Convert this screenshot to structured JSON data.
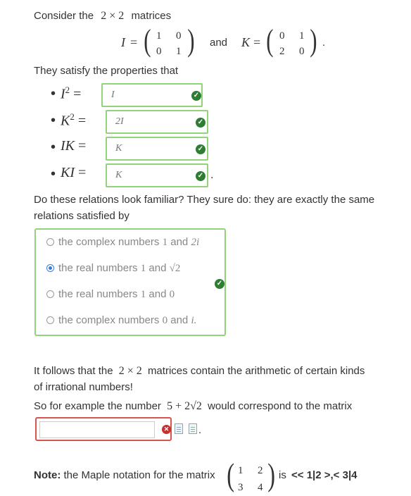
{
  "intro": {
    "text": "Consider the",
    "size_expr": "2 × 2",
    "suffix": "matrices"
  },
  "matrices": {
    "I_label": "I",
    "I_rows": [
      [
        "1",
        "0"
      ],
      [
        "0",
        "1"
      ]
    ],
    "and_text": "and",
    "K_label": "K",
    "K_rows": [
      [
        "0",
        "1"
      ],
      [
        "2",
        "0"
      ]
    ],
    "equals": "=",
    "period": "."
  },
  "properties": {
    "intro": "They satisfy the properties that",
    "items": [
      {
        "lhs_var": "I",
        "lhs_exp": "2",
        "answer": "I",
        "status": "correct"
      },
      {
        "lhs_var": "K",
        "lhs_exp": "2",
        "answer": "2I",
        "status": "correct"
      },
      {
        "lhs_var": "IK",
        "lhs_exp": "",
        "answer": "K",
        "status": "correct"
      },
      {
        "lhs_var": "KI",
        "lhs_exp": "",
        "answer": "K",
        "status": "correct"
      }
    ],
    "bullet": "•",
    "trailing": "."
  },
  "question": {
    "line1": "Do these relations look familiar? They sure do: they are exactly the same",
    "line2": "relations satisfied by"
  },
  "choices": {
    "options": [
      {
        "label": "the complex numbers",
        "a": "1",
        "and": "and",
        "b": "2i",
        "selected": false
      },
      {
        "label": "the real numbers",
        "a": "1",
        "and": "and",
        "b": "√2",
        "selected": true
      },
      {
        "label": "the real numbers",
        "a": "1",
        "and": "and",
        "b": "0",
        "selected": false
      },
      {
        "label": "the complex numbers",
        "a": "0",
        "and": "and",
        "b": "i.",
        "selected": false
      }
    ],
    "status": "correct"
  },
  "followup": {
    "line1_a": "It follows that the",
    "line1_expr": "2 × 2",
    "line1_b": "matrices contain the arithmetic of certain kinds",
    "line2": "of irrational numbers!",
    "line3_a": "So for example the number",
    "line3_expr": "5 + 2√2",
    "line3_b": "would correspond to the matrix",
    "answer_value": "",
    "status": "incorrect",
    "trailing": "."
  },
  "note": {
    "bold": "Note:",
    "text": "the Maple notation for the matrix",
    "rows": [
      [
        "1",
        "2"
      ],
      [
        "3",
        "4"
      ]
    ],
    "is": "is",
    "maple": "<< 1|2 >,< 3|4"
  },
  "colors": {
    "correct_border": "#92d27a",
    "correct_icon": "#2e7d32",
    "incorrect_border": "#d9534f",
    "radio_selected": "#3a7bd5"
  }
}
